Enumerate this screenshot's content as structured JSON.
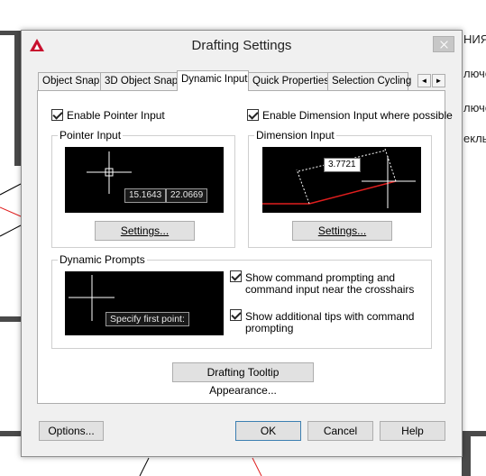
{
  "background": {
    "text_lines": [
      "НИЯ",
      "лючо",
      "лючо",
      "екль"
    ]
  },
  "dialog": {
    "title": "Drafting Settings",
    "tabs": [
      {
        "label": "Object Snap",
        "active": false
      },
      {
        "label": "3D Object Snap",
        "active": false
      },
      {
        "label": "Dynamic Input",
        "active": true
      },
      {
        "label": "Quick Properties",
        "active": false
      },
      {
        "label": "Selection Cycling",
        "active": false
      }
    ],
    "tab_scroll_left": "◄",
    "tab_scroll_right": "►",
    "enable_pointer_input": {
      "label": "Enable Pointer Input",
      "checked": true
    },
    "enable_dimension_input": {
      "label": "Enable Dimension Input where possible",
      "checked": true
    },
    "pointer_input": {
      "group_label": "Pointer Input",
      "x_value": "15.1643",
      "y_value": "22.0669",
      "settings_button": "Settings..."
    },
    "dimension_input": {
      "group_label": "Dimension Input",
      "length_value": "3.7721",
      "settings_button": "Settings..."
    },
    "dynamic_prompts": {
      "group_label": "Dynamic Prompts",
      "prompt_text": "Specify first point:",
      "show_command_prompting": {
        "label_line1": "Show command prompting and",
        "label_line2": "command input near the crosshairs",
        "checked": true
      },
      "show_additional_tips": {
        "label_line1": "Show additional tips with command",
        "label_line2": "prompting",
        "checked": true
      }
    },
    "tooltip_appearance_button": "Drafting Tooltip Appearance...",
    "footer": {
      "options_button": "Options...",
      "ok_button": "OK",
      "cancel_button": "Cancel",
      "help_button": "Help"
    },
    "colors": {
      "accent_red": "#e01e1e",
      "preview_bg": "#000000",
      "dialog_bg": "#f0f0f0"
    }
  }
}
